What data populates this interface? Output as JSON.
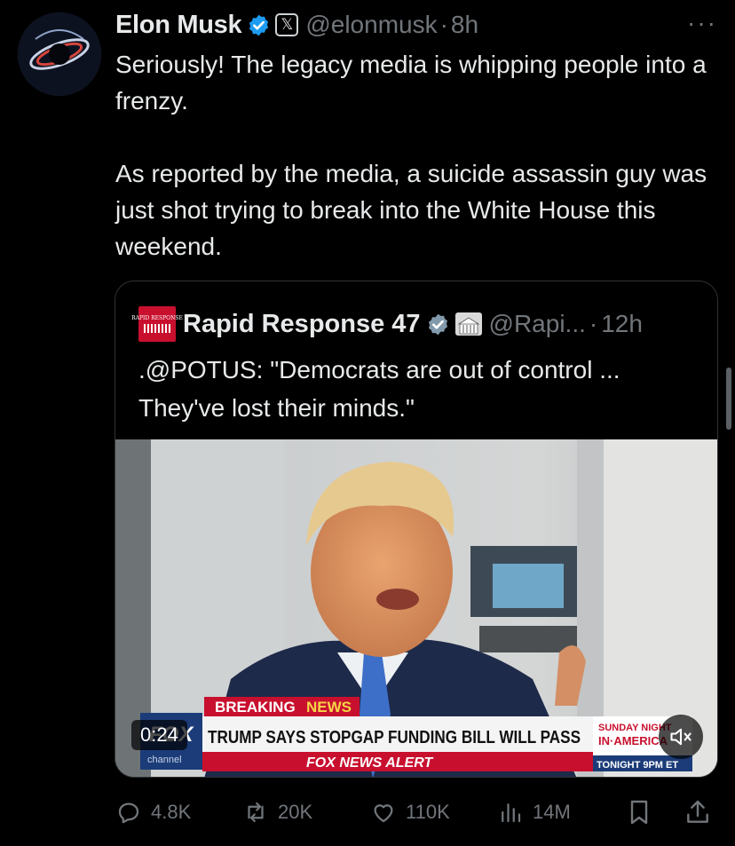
{
  "author": {
    "name": "Elon Musk",
    "handle": "@elonmusk",
    "time": "8h",
    "badge_glyph": "𝕏"
  },
  "more_label": "···",
  "tweet_text": "Seriously! The legacy media is whipping people into a frenzy.\n\nAs reported by the media, a suicide assassin guy was just shot trying to break into the White House this weekend.",
  "quoted": {
    "name": "Rapid Response 47",
    "handle": "@Rapi...",
    "time": "12h",
    "logo_text": "RAPID RESPONSE",
    "text": ".@POTUS: \"Democrats are out of control ... They've lost their minds.\"",
    "video": {
      "duration": "0:24",
      "breaking_label_1": "BREAKING",
      "breaking_label_2": "NEWS",
      "headline": "TRUMP SAYS STOPGAP FUNDING BILL WILL PASS",
      "alert": "FOX NEWS ALERT",
      "network": "FOX",
      "network_sub": "channel",
      "promo_top": "SUNDAY NIGHT",
      "promo_mid": "IN·AMERICA",
      "promo_bottom": "TONIGHT 9PM ET"
    }
  },
  "actions": {
    "replies": "4.8K",
    "reposts": "20K",
    "likes": "110K",
    "views": "14M"
  },
  "colors": {
    "background": "#000000",
    "text": "#e7e9ea",
    "muted": "#71767b",
    "verified": "#1d9bf0",
    "fox_red": "#c8102e"
  }
}
